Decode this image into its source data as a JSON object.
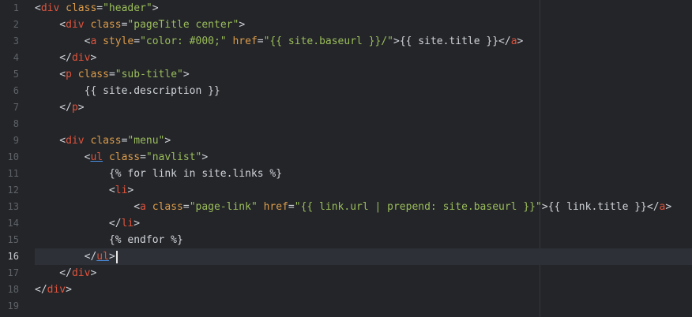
{
  "editor": {
    "active_line": 16,
    "lines": [
      {
        "n": "1",
        "parts": [
          [
            "p",
            "<"
          ],
          [
            "t",
            "div"
          ],
          [
            "p",
            " "
          ],
          [
            "a",
            "class"
          ],
          [
            "p",
            "="
          ],
          [
            "s",
            "\"header\""
          ],
          [
            "p",
            ">"
          ]
        ]
      },
      {
        "n": "2",
        "parts": [
          [
            "p",
            "    <"
          ],
          [
            "t",
            "div"
          ],
          [
            "p",
            " "
          ],
          [
            "a",
            "class"
          ],
          [
            "p",
            "="
          ],
          [
            "s",
            "\"pageTitle center\""
          ],
          [
            "p",
            ">"
          ]
        ]
      },
      {
        "n": "3",
        "parts": [
          [
            "p",
            "        <"
          ],
          [
            "t",
            "a"
          ],
          [
            "p",
            " "
          ],
          [
            "a",
            "style"
          ],
          [
            "p",
            "="
          ],
          [
            "s",
            "\"color: #000;\""
          ],
          [
            "p",
            " "
          ],
          [
            "a",
            "href"
          ],
          [
            "p",
            "="
          ],
          [
            "s",
            "\"{{ site.baseurl }}/\""
          ],
          [
            "p",
            ">{{ site.title }}</"
          ],
          [
            "t",
            "a"
          ],
          [
            "p",
            ">"
          ]
        ]
      },
      {
        "n": "4",
        "parts": [
          [
            "p",
            "    </"
          ],
          [
            "t",
            "div"
          ],
          [
            "p",
            ">"
          ]
        ]
      },
      {
        "n": "5",
        "parts": [
          [
            "p",
            "    <"
          ],
          [
            "t",
            "p"
          ],
          [
            "p",
            " "
          ],
          [
            "a",
            "class"
          ],
          [
            "p",
            "="
          ],
          [
            "s",
            "\"sub-title\""
          ],
          [
            "p",
            ">"
          ]
        ]
      },
      {
        "n": "6",
        "parts": [
          [
            "p",
            "        {{ site.description }}"
          ]
        ]
      },
      {
        "n": "7",
        "parts": [
          [
            "p",
            "    </"
          ],
          [
            "t",
            "p"
          ],
          [
            "p",
            ">"
          ]
        ]
      },
      {
        "n": "8",
        "parts": []
      },
      {
        "n": "9",
        "parts": [
          [
            "p",
            "    <"
          ],
          [
            "t",
            "div"
          ],
          [
            "p",
            " "
          ],
          [
            "a",
            "class"
          ],
          [
            "p",
            "="
          ],
          [
            "s",
            "\"menu\""
          ],
          [
            "p",
            ">"
          ]
        ]
      },
      {
        "n": "10",
        "parts": [
          [
            "p",
            "        <"
          ],
          [
            "tu",
            "ul"
          ],
          [
            "p",
            " "
          ],
          [
            "a",
            "class"
          ],
          [
            "p",
            "="
          ],
          [
            "s",
            "\"navlist\""
          ],
          [
            "p",
            ">"
          ]
        ]
      },
      {
        "n": "11",
        "parts": [
          [
            "p",
            "            {% for link in site.links %}"
          ]
        ]
      },
      {
        "n": "12",
        "parts": [
          [
            "p",
            "            <"
          ],
          [
            "t",
            "li"
          ],
          [
            "p",
            ">"
          ]
        ]
      },
      {
        "n": "13",
        "parts": [
          [
            "p",
            "                <"
          ],
          [
            "t",
            "a"
          ],
          [
            "p",
            " "
          ],
          [
            "a",
            "class"
          ],
          [
            "p",
            "="
          ],
          [
            "s",
            "\"page-link\""
          ],
          [
            "p",
            " "
          ],
          [
            "a",
            "href"
          ],
          [
            "p",
            "="
          ],
          [
            "s",
            "\"{{ link.url | prepend: site.baseurl }}\""
          ],
          [
            "p",
            ">{{ link.title }}</"
          ],
          [
            "t",
            "a"
          ],
          [
            "p",
            ">"
          ]
        ]
      },
      {
        "n": "14",
        "parts": [
          [
            "p",
            "            </"
          ],
          [
            "t",
            "li"
          ],
          [
            "p",
            ">"
          ]
        ]
      },
      {
        "n": "15",
        "parts": [
          [
            "p",
            "            {% endfor %}"
          ]
        ]
      },
      {
        "n": "16",
        "parts": [
          [
            "p",
            "        </"
          ],
          [
            "tu",
            "ul"
          ],
          [
            "p",
            ">"
          ]
        ],
        "cursor": true
      },
      {
        "n": "17",
        "parts": [
          [
            "p",
            "    </"
          ],
          [
            "t",
            "div"
          ],
          [
            "p",
            ">"
          ]
        ]
      },
      {
        "n": "18",
        "parts": [
          [
            "p",
            "</"
          ],
          [
            "t",
            "div"
          ],
          [
            "p",
            ">"
          ]
        ]
      },
      {
        "n": "19",
        "parts": []
      }
    ]
  }
}
